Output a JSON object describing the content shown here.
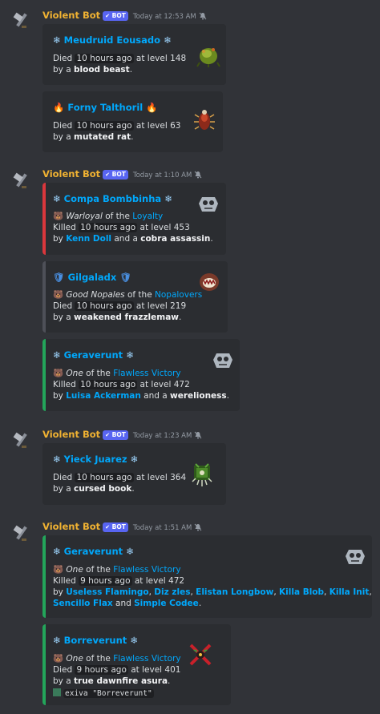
{
  "colors": {
    "background": "#313338",
    "embed_bg": "#2b2d31",
    "author": "#f0b232",
    "link": "#00a8fc",
    "bot_badge": "#5865f2",
    "bar_red": "#da373c",
    "bar_grey": "#4e5058",
    "bar_green": "#23a55a"
  },
  "messages": [
    {
      "author": "Violent Bot",
      "badge": "BOT",
      "time": "Today at 12:53 AM",
      "embeds": [
        {
          "title": "Meudruid Eousado",
          "l1_pre": "Died ",
          "l1_code": "10 hours ago",
          "l1_post": " at level 148",
          "l2_pre": "by a ",
          "l2_bold": "blood beast",
          "l2_post": "."
        },
        {
          "title": "Forny Talthoril",
          "l1_pre": "Died ",
          "l1_code": "10 hours ago",
          "l1_post": " at level 63",
          "l2_pre": "by a ",
          "l2_bold": "mutated rat",
          "l2_post": "."
        }
      ]
    },
    {
      "author": "Violent Bot",
      "badge": "BOT",
      "time": "Today at 1:10 AM",
      "embeds": [
        {
          "title": "Compa Bombbinha",
          "g_italic": "Warloyal",
          "g_mid": " of the ",
          "g_link": "Loyalty",
          "l1_pre": "Killed ",
          "l1_code": "10 hours ago",
          "l1_post": " at level 453",
          "l2_pre": "by ",
          "l2_link": "Kenn Doll",
          "l2_mid": " and a ",
          "l2_bold": "cobra assassin",
          "l2_post": "."
        },
        {
          "title": "Gilgaladx",
          "g_italic": "Good Nopales",
          "g_mid": " of the ",
          "g_link": "Nopalovers",
          "l1_pre": "Died ",
          "l1_code": "10 hours ago",
          "l1_post": " at level 219",
          "l2_pre": "by a ",
          "l2_bold": "weakened frazzlemaw",
          "l2_post": "."
        },
        {
          "title": "Geraverunt",
          "g_italic": "One",
          "g_mid": " of the ",
          "g_link": "Flawless Victory",
          "l1_pre": "Killed ",
          "l1_code": "10 hours ago",
          "l1_post": " at level 472",
          "l2_pre": "by ",
          "l2_link": "Luisa Ackerman",
          "l2_mid": " and a ",
          "l2_bold": "werelioness",
          "l2_post": "."
        }
      ]
    },
    {
      "author": "Violent Bot",
      "badge": "BOT",
      "time": "Today at 1:23 AM",
      "embeds": [
        {
          "title": "Yieck Juarez",
          "l1_pre": "Died ",
          "l1_code": "10 hours ago",
          "l1_post": " at level 364",
          "l2_pre": "by a ",
          "l2_bold": "cursed book",
          "l2_post": "."
        }
      ]
    },
    {
      "author": "Violent Bot",
      "badge": "BOT",
      "time": "Today at 1:51 AM",
      "embeds": [
        {
          "title": "Geraverunt",
          "g_italic": "One",
          "g_mid": " of the ",
          "g_link": "Flawless Victory",
          "l1_pre": "Killed ",
          "l1_code": "9 hours ago",
          "l1_post": " at level 472",
          "l2_pre": "by ",
          "killers": [
            "Useless Flamingo",
            "Diz zles",
            "Elistan Longbow",
            "Killa Blob",
            "Killa Init",
            "Sencillo Flax",
            "Simple Codee"
          ],
          "sep_comma": ", ",
          "sep_and": " and ",
          "l3_post": "."
        },
        {
          "title": "Borreverunt",
          "g_italic": "One",
          "g_mid": " of the ",
          "g_link": "Flawless Victory",
          "l1_pre": "Died ",
          "l1_code": "9 hours ago",
          "l1_post": " at level 401",
          "l2_pre": "by a ",
          "l2_bold": "true dawnfire asura",
          "l2_post": ".",
          "command": "exiva \"Borreverunt\""
        }
      ]
    }
  ]
}
